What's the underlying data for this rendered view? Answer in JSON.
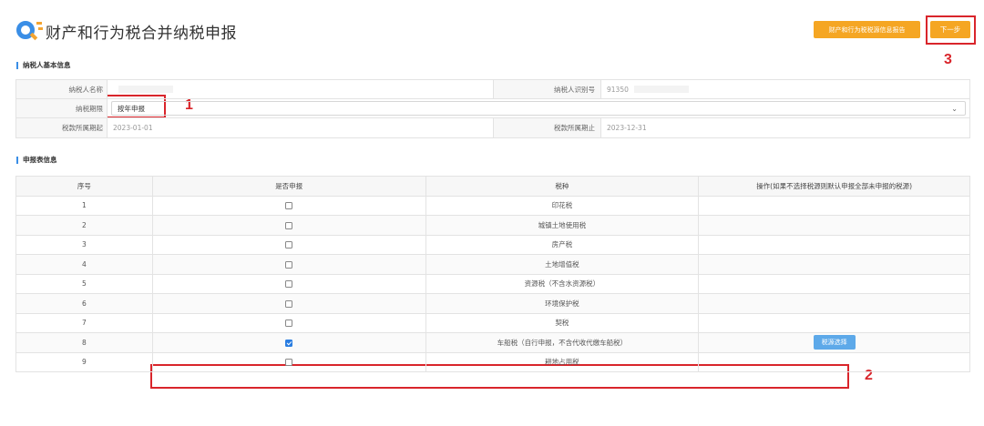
{
  "header": {
    "title": "财产和行为税合并纳税申报",
    "report_button": "财产和行为税税源信息报告",
    "next_button": "下一步"
  },
  "annotations": {
    "n1": "1",
    "n2": "2",
    "n3": "3"
  },
  "colors": {
    "accent": "#3a8ee6",
    "orange": "#f5a623",
    "highlight": "#d9252b"
  },
  "basic_info": {
    "section_title": "纳税人基本信息",
    "taxpayer_name_label": "纳税人名称",
    "taxpayer_id_label": "纳税人识别号",
    "taxpayer_id_value": "91350",
    "period_label": "纳税期限",
    "period_value": "按年申报",
    "start_label": "税款所属期起",
    "start_value": "2023-01-01",
    "end_label": "税款所属期止",
    "end_value": "2023-12-31"
  },
  "declaration": {
    "section_title": "申报表信息",
    "columns": [
      "序号",
      "是否申报",
      "税种",
      "操作(如果不选择税源则默认申报全部未申报的税源)"
    ],
    "rows": [
      {
        "no": "1",
        "tax": "印花税",
        "checked": false
      },
      {
        "no": "2",
        "tax": "城镇土地使用税",
        "checked": false
      },
      {
        "no": "3",
        "tax": "房产税",
        "checked": false
      },
      {
        "no": "4",
        "tax": "土地增值税",
        "checked": false
      },
      {
        "no": "5",
        "tax": "资源税（不含水资源税）",
        "checked": false
      },
      {
        "no": "6",
        "tax": "环境保护税",
        "checked": false
      },
      {
        "no": "7",
        "tax": "契税",
        "checked": false
      },
      {
        "no": "8",
        "tax": "车船税（自行申报，不含代收代缴车船税）",
        "checked": true,
        "action": "税源选择"
      },
      {
        "no": "9",
        "tax": "耕地占用税",
        "checked": false
      }
    ]
  }
}
